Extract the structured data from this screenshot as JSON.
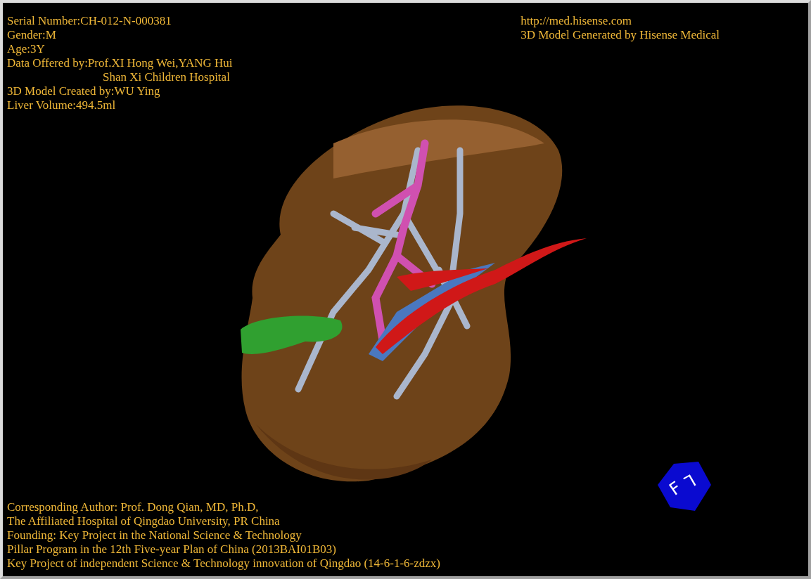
{
  "patient_info": [
    {
      "text": "Serial Number:CH-012-N-000381",
      "kind": "line"
    },
    {
      "text": "Gender:M",
      "kind": "line"
    },
    {
      "text": "Age:3Y",
      "kind": "line"
    },
    {
      "text": "Data Offered by:Prof.XI Hong Wei,YANG Hui",
      "kind": "line"
    },
    {
      "text": "Shan Xi Children Hospital",
      "kind": "continued"
    },
    {
      "text": "3D Model Created by:WU Ying",
      "kind": "line"
    },
    {
      "text": "Liver Volume:494.5ml",
      "kind": "line"
    }
  ],
  "source_info": {
    "website": "http://med.hisense.com",
    "generator": "3D Model Generated by Hisense Medical"
  },
  "credits": [
    "Corresponding Author: Prof. Dong Qian, MD, Ph.D,",
    "The Affiliated Hospital of Qingdao University, PR China",
    "Founding: Key Project in the National Science & Technology",
    "Pillar Program in the 12th Five-year Plan of China (2013BAI01B03)",
    "Key Project of independent Science & Technology innovation of Qingdao (14-6-1-6-zdzx)"
  ],
  "orientation_cube": {
    "faces": [
      "F",
      "L"
    ]
  }
}
